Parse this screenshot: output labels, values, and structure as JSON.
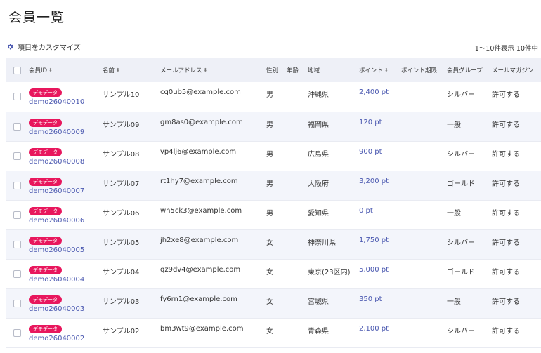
{
  "page": {
    "title": "会員一覧",
    "customize_label": "項目をカスタマイズ",
    "count_text": "1〜10件表示 10件中"
  },
  "table": {
    "columns": [
      "会員ID",
      "名前",
      "メールアドレス",
      "性別",
      "年齢",
      "地域",
      "ポイント",
      "ポイント期限",
      "会員グループ",
      "メールマガジン"
    ],
    "sortable": [
      true,
      true,
      true,
      false,
      false,
      false,
      true,
      false,
      false,
      false
    ],
    "rows": [
      {
        "badge": "デモデータ",
        "id": "demo26040010",
        "name": "サンプル10",
        "email": "cq0ub5@example.com",
        "gender": "男",
        "age": "",
        "region": "沖縄県",
        "points": "2,400 pt",
        "expiry": "",
        "group": "シルバー",
        "newsletter": "許可する"
      },
      {
        "badge": "デモデータ",
        "id": "demo26040009",
        "name": "サンプル09",
        "email": "gm8as0@example.com",
        "gender": "男",
        "age": "",
        "region": "福岡県",
        "points": "120 pt",
        "expiry": "",
        "group": "一般",
        "newsletter": "許可する"
      },
      {
        "badge": "デモデータ",
        "id": "demo26040008",
        "name": "サンプル08",
        "email": "vp4lj6@example.com",
        "gender": "男",
        "age": "",
        "region": "広島県",
        "points": "900 pt",
        "expiry": "",
        "group": "シルバー",
        "newsletter": "許可する"
      },
      {
        "badge": "デモデータ",
        "id": "demo26040007",
        "name": "サンプル07",
        "email": "rt1hy7@example.com",
        "gender": "男",
        "age": "",
        "region": "大阪府",
        "points": "3,200 pt",
        "expiry": "",
        "group": "ゴールド",
        "newsletter": "許可する"
      },
      {
        "badge": "デモデータ",
        "id": "demo26040006",
        "name": "サンプル06",
        "email": "wn5ck3@example.com",
        "gender": "男",
        "age": "",
        "region": "愛知県",
        "points": "0 pt",
        "expiry": "",
        "group": "一般",
        "newsletter": "許可する"
      },
      {
        "badge": "デモデータ",
        "id": "demo26040005",
        "name": "サンプル05",
        "email": "jh2xe8@example.com",
        "gender": "女",
        "age": "",
        "region": "神奈川県",
        "points": "1,750 pt",
        "expiry": "",
        "group": "シルバー",
        "newsletter": "許可する"
      },
      {
        "badge": "デモデータ",
        "id": "demo26040004",
        "name": "サンプル04",
        "email": "qz9dv4@example.com",
        "gender": "女",
        "age": "",
        "region": "東京(23区内)",
        "points": "5,000 pt",
        "expiry": "",
        "group": "ゴールド",
        "newsletter": "許可する"
      },
      {
        "badge": "デモデータ",
        "id": "demo26040003",
        "name": "サンプル03",
        "email": "fy6rn1@example.com",
        "gender": "女",
        "age": "",
        "region": "宮城県",
        "points": "350 pt",
        "expiry": "",
        "group": "一般",
        "newsletter": "許可する"
      },
      {
        "badge": "デモデータ",
        "id": "demo26040002",
        "name": "サンプル02",
        "email": "bm3wt9@example.com",
        "gender": "女",
        "age": "",
        "region": "青森県",
        "points": "2,100 pt",
        "expiry": "",
        "group": "シルバー",
        "newsletter": "許可する"
      }
    ]
  },
  "colors": {
    "accent": "#4a58b0",
    "badge": "#e8175d",
    "header_bg": "#eef0f7",
    "stripe_bg": "#f3f5fb"
  },
  "icons": {
    "customize": "gear-icon",
    "sort": "sort-arrows-icon"
  }
}
